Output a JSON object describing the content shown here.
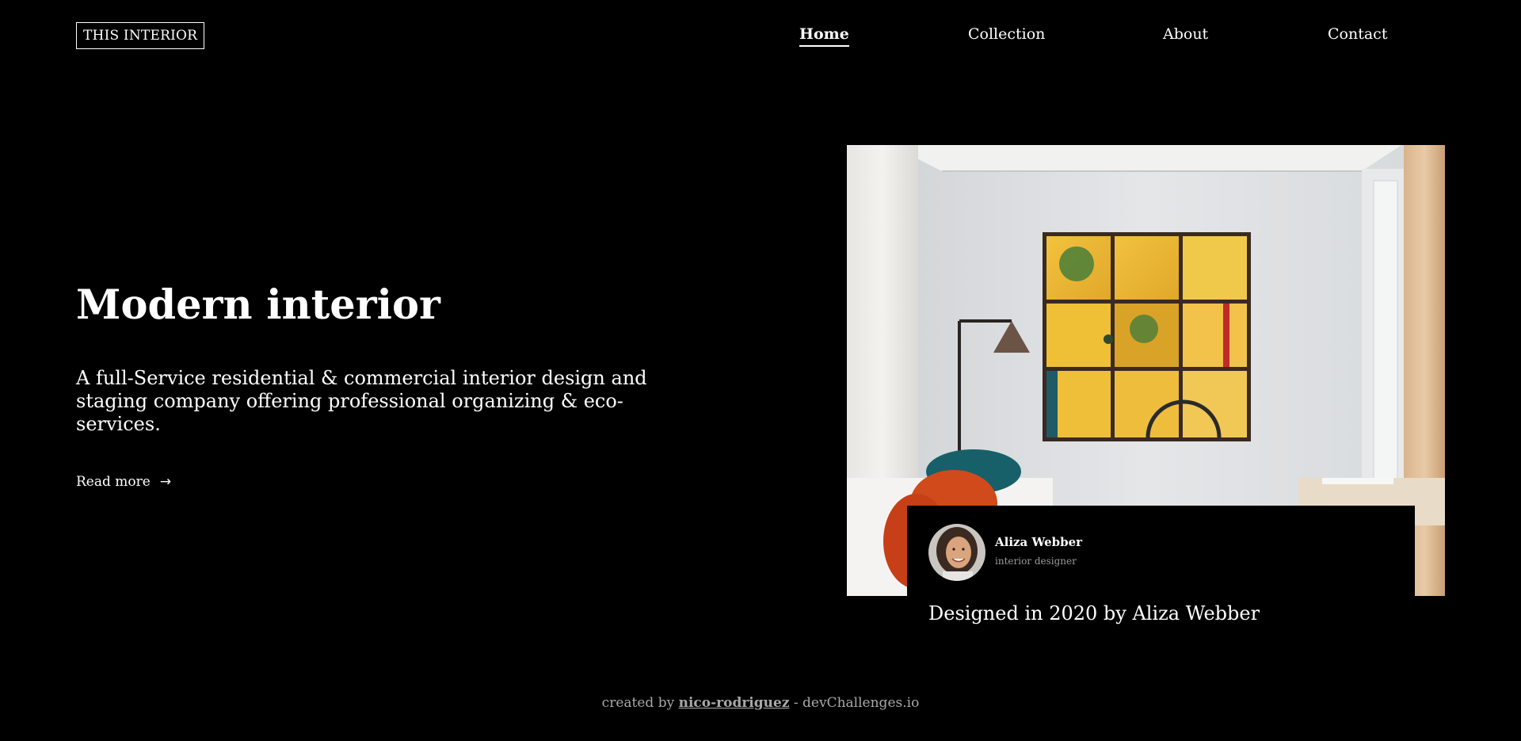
{
  "header": {
    "logo": "THIS INTERIOR",
    "nav": [
      {
        "label": "Home",
        "active": true
      },
      {
        "label": "Collection",
        "active": false
      },
      {
        "label": "About",
        "active": false
      },
      {
        "label": "Contact",
        "active": false
      }
    ]
  },
  "hero": {
    "title": "Modern interior",
    "description": "A full-Service residential & commercial interior design and staging company offering professional organizing & eco-services.",
    "read_more": "Read more",
    "read_more_icon": "arrow-right-icon"
  },
  "featured": {
    "image": "living-room-photo",
    "designer_name": "Aliza Webber",
    "designer_role": "interior designer",
    "caption": "Designed in 2020 by Aliza Webber"
  },
  "footer": {
    "prefix": "created by",
    "author": "nico-rodriguez",
    "suffix": "- devChallenges.io"
  }
}
